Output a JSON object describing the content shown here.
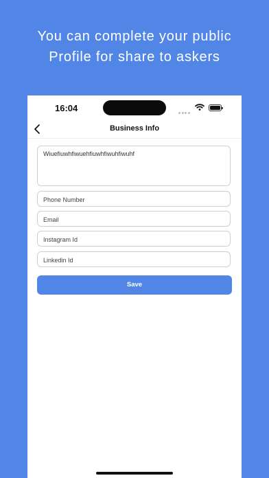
{
  "promo": {
    "line1": "You can complete your public",
    "line2": "Profile for share to askers"
  },
  "status_bar": {
    "time": "16:04"
  },
  "nav": {
    "title": "Business Info",
    "back_icon": "chevron-left-icon"
  },
  "form": {
    "bio_value": "Wiuefiuwhfiwuehfiuwhfiwuhfiwuhf",
    "phone_placeholder": "Phone Number",
    "email_placeholder": "Email",
    "instagram_placeholder": "Instagram Id",
    "linkedin_placeholder": "Linkedin Id",
    "save_label": "Save"
  },
  "colors": {
    "background": "#5286E6",
    "accent": "#5286E6",
    "field_border": "#cfcfcf"
  }
}
